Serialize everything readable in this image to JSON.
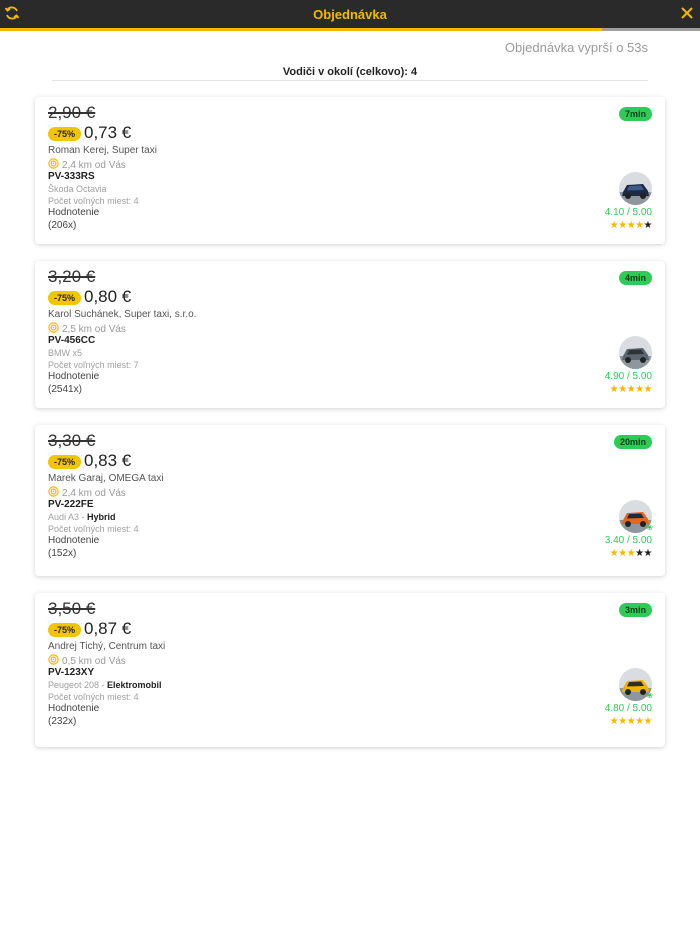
{
  "header": {
    "title": "Objednávka",
    "colors": {
      "bar": "#2a2a2a",
      "accent": "#f5b800"
    },
    "left_icon": "refresh-icon",
    "right_icon": "close-icon"
  },
  "expiry_text": "Objednávka vyprší o 53s",
  "drivers_count_text": "Vodiči v okolí (celkovo): 4",
  "labels": {
    "rating": "Hodnotenie"
  },
  "offers": [
    {
      "old_price": "2,90 €",
      "discount": "-75%",
      "new_price": "0,73 €",
      "driver": "Roman Kerej, Super taxi",
      "distance": "2,4 km od Vás",
      "plate": "PV-333RS",
      "car_model": "Škoda Octavia",
      "car_tag": "",
      "seats": "Počet voľných miest: 4",
      "rating_count": "(206x)",
      "eta": "7min",
      "rating_value": "4.10 / 5.00",
      "stars": 4,
      "eco": false
    },
    {
      "old_price": "3,20 €",
      "discount": "-75%",
      "new_price": "0,80 €",
      "driver": "Karol Suchánek, Super taxi, s.r.o.",
      "distance": "2,5 km od Vás",
      "plate": "PV-456CC",
      "car_model": "BMW x5",
      "car_tag": "",
      "seats": "Počet voľných miest: 7",
      "rating_count": "(2541x)",
      "eta": "4min",
      "rating_value": "4.90 / 5.00",
      "stars": 5,
      "eco": false
    },
    {
      "old_price": "3,30 €",
      "discount": "-75%",
      "new_price": "0,83 €",
      "driver": "Marek Garaj, OMEGA taxi",
      "distance": "2,4 km od Vás",
      "plate": "PV-222FE",
      "car_model": "Audi A3 - ",
      "car_tag": "Hybrid",
      "seats": "Počet voľných miest: 4",
      "rating_count": "(152x)",
      "eta": "20min",
      "rating_value": "3.40 / 5.00",
      "stars": 3,
      "eco": true
    },
    {
      "old_price": "3,50 €",
      "discount": "-75%",
      "new_price": "0,87 €",
      "driver": "Andrej Tichý, Centrum taxi",
      "distance": "0,5 km od Vás",
      "plate": "PV-123XY",
      "car_model": "Peugeot 208 - ",
      "car_tag": "Elektromobil",
      "seats": "Počet voľných miest: 4",
      "rating_count": "(232x)",
      "eta": "3min",
      "rating_value": "4.80 / 5.00",
      "stars": 5,
      "eco": true
    }
  ]
}
